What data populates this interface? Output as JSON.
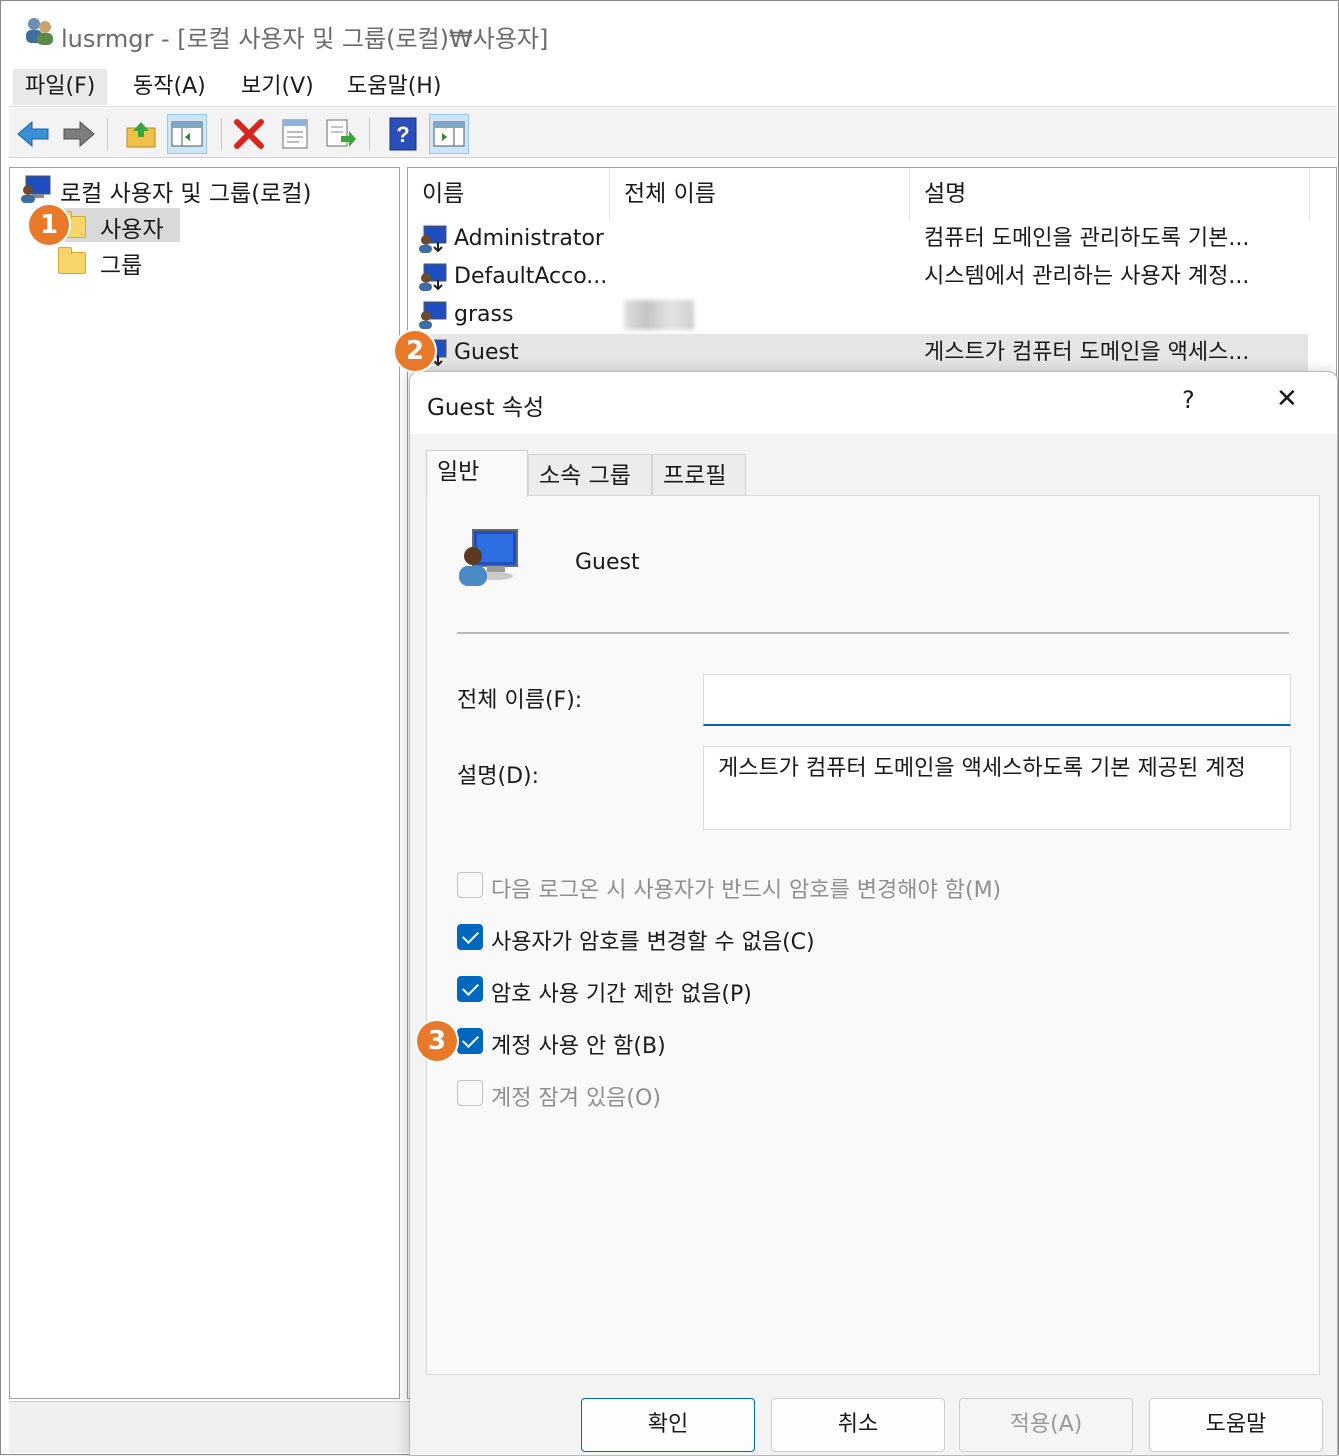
{
  "window": {
    "title": "lusrmgr - [로컬 사용자 및 그룹(로컬)₩사용자]"
  },
  "menu": [
    "파일(F)",
    "동작(A)",
    "보기(V)",
    "도움말(H)"
  ],
  "toolbar": {
    "icons": [
      "back-arrow-icon",
      "forward-arrow-icon",
      "up-folder-icon",
      "show-hide-tree-icon",
      "delete-icon",
      "properties-icon",
      "export-list-icon",
      "help-icon",
      "action-pane-icon"
    ]
  },
  "tree": {
    "root": "로컬 사용자 및 그룹(로컬)",
    "items": [
      "사용자",
      "그룹"
    ],
    "selected": "사용자"
  },
  "list": {
    "columns": [
      "이름",
      "전체 이름",
      "설명"
    ],
    "rows": [
      {
        "name": "Administrator",
        "full_name": "",
        "description": "컴퓨터 도메인을 관리하도록 기본..."
      },
      {
        "name": "DefaultAcco...",
        "full_name": "",
        "description": "시스템에서 관리하는 사용자 계정..."
      },
      {
        "name": "grass",
        "full_name": "",
        "description": ""
      },
      {
        "name": "Guest",
        "full_name": "",
        "description": "게스트가 컴퓨터 도메인을 액세스..."
      }
    ],
    "selected_row": "Guest"
  },
  "dialog": {
    "title": "Guest 속성",
    "help_glyph": "?",
    "close_glyph": "✕",
    "tabs": [
      "일반",
      "소속 그룹",
      "프로필"
    ],
    "active_tab": "일반",
    "user_name": "Guest",
    "full_name_label": "전체 이름(F):",
    "full_name_value": "",
    "description_label": "설명(D):",
    "description_value": "게스트가 컴퓨터 도메인을 액세스하도록 기본 제공된 계정",
    "checkboxes": [
      {
        "label": "다음 로그온 시 사용자가 반드시 암호를 변경해야 함(M)",
        "checked": false,
        "disabled": true
      },
      {
        "label": "사용자가 암호를 변경할 수 없음(C)",
        "checked": true,
        "disabled": false
      },
      {
        "label": "암호 사용 기간 제한 없음(P)",
        "checked": true,
        "disabled": false
      },
      {
        "label": "계정 사용 안 함(B)",
        "checked": true,
        "disabled": false
      },
      {
        "label": "계정 잠겨 있음(O)",
        "checked": false,
        "disabled": true
      }
    ],
    "buttons": {
      "ok": "확인",
      "cancel": "취소",
      "apply": "적용(A)",
      "help": "도움말"
    }
  },
  "badges": [
    "1",
    "2",
    "3"
  ],
  "colors": {
    "accent": "#0067c0",
    "badge": "#e8792b",
    "selection": "#e5e5e5"
  }
}
